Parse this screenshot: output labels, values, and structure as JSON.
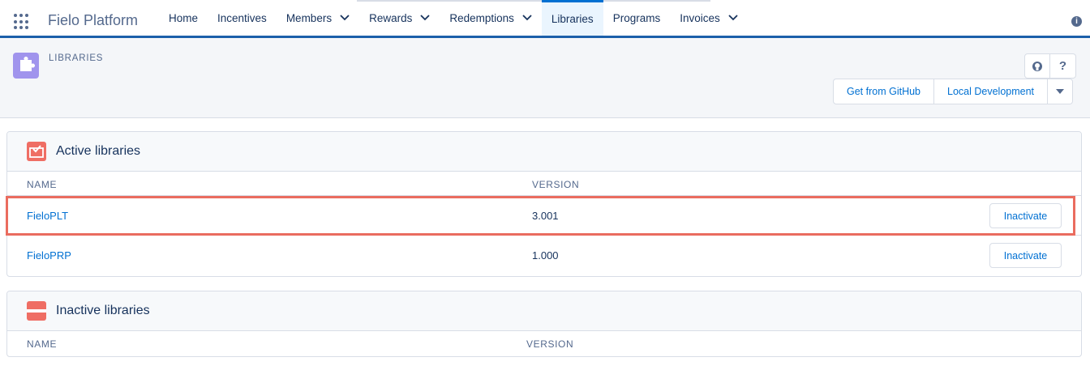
{
  "nav": {
    "app_name": "Fielo Platform",
    "items": [
      {
        "label": "Home",
        "dropdown": false,
        "active": false
      },
      {
        "label": "Incentives",
        "dropdown": false,
        "active": false
      },
      {
        "label": "Members",
        "dropdown": true,
        "active": false
      },
      {
        "label": "Rewards",
        "dropdown": true,
        "active": false
      },
      {
        "label": "Redemptions",
        "dropdown": true,
        "active": false
      },
      {
        "label": "Libraries",
        "dropdown": false,
        "active": true
      },
      {
        "label": "Programs",
        "dropdown": false,
        "active": false
      },
      {
        "label": "Invoices",
        "dropdown": true,
        "active": false
      }
    ],
    "info_icon": "i"
  },
  "header": {
    "object_label": "LIBRARIES",
    "icon_buttons": [
      "github-icon",
      "?"
    ],
    "buttons": [
      "Get from GitHub",
      "Local Development"
    ]
  },
  "active_card": {
    "title": "Active libraries",
    "columns": [
      "NAME",
      "VERSION"
    ],
    "rows": [
      {
        "name": "FieloPLT",
        "version": "3.001",
        "action": "Inactivate"
      },
      {
        "name": "FieloPRP",
        "version": "1.000",
        "action": "Inactivate"
      }
    ]
  },
  "inactive_card": {
    "title": "Inactive libraries",
    "columns": [
      "NAME",
      "VERSION"
    ]
  },
  "colors": {
    "brand_blue": "#0070d2",
    "nav_underline": "#1b5faa",
    "object_icon": "#a094ed",
    "card_icon": "#ef6e64",
    "highlight": "#ea6c5f"
  }
}
